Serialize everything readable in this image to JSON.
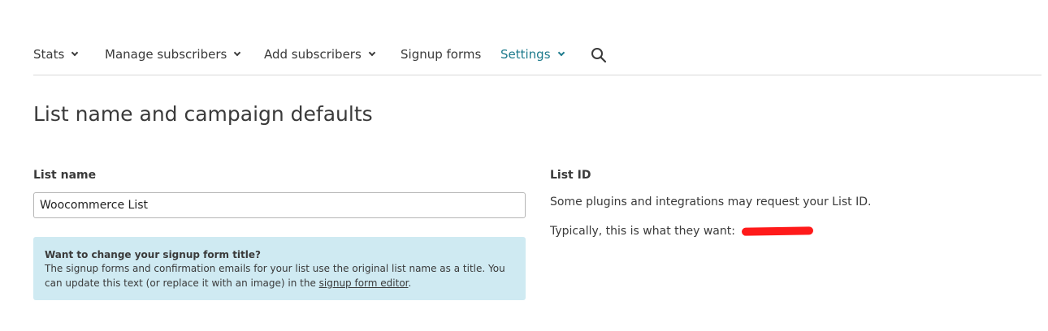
{
  "nav": {
    "items": [
      {
        "label": "Stats",
        "has_dropdown": true,
        "active": false
      },
      {
        "label": "Manage subscribers",
        "has_dropdown": true,
        "active": false
      },
      {
        "label": "Add subscribers",
        "has_dropdown": true,
        "active": false
      },
      {
        "label": "Signup forms",
        "has_dropdown": false,
        "active": false
      },
      {
        "label": "Settings",
        "has_dropdown": true,
        "active": true
      }
    ],
    "search_icon": "search-icon"
  },
  "page": {
    "title": "List name and campaign defaults"
  },
  "list_name": {
    "label": "List name",
    "value": "Woocommerce List"
  },
  "notice": {
    "title": "Want to change your signup form title?",
    "body_before_link": "The signup forms and confirmation emails for your list use the original list name as a title. You can update this text (or replace it with an image) in the ",
    "link_text": "signup form editor",
    "body_after_link": "."
  },
  "list_id": {
    "label": "List ID",
    "description": "Some plugins and integrations may request your List ID.",
    "typical_prefix": "Typically, this is what they want:"
  },
  "colors": {
    "accent": "#1d7a8c",
    "notice_bg": "#cfeaf2",
    "redaction": "#ff1a1a"
  }
}
